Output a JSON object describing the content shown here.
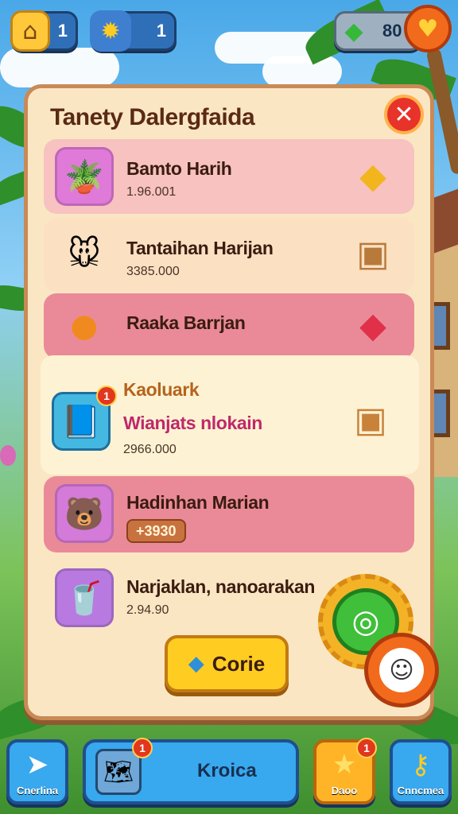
{
  "hud": {
    "home_value": "1",
    "star_value": "1",
    "gem_value": "80"
  },
  "panel": {
    "title": "Tanety Dalergfaida"
  },
  "items": [
    {
      "name": "Bamto Harih",
      "value": "1.96.001"
    },
    {
      "name": "Tantaihan Harijan",
      "value": "3385.000"
    },
    {
      "name": "Raaka Barrjan",
      "value": ""
    },
    {
      "name": "Kaoluark",
      "subtitle": "Wianjats nlokain",
      "value": "2966.000",
      "badge": "1"
    },
    {
      "name": "Hadinhan Marian",
      "value": "+3930"
    },
    {
      "name": "Narjaklan, nanoarakan",
      "value": "2.94.90"
    }
  ],
  "go_button": {
    "label": "Corie"
  },
  "bottom_nav": {
    "left_label": "Cnerlina",
    "main_label": "Kroica",
    "main_badge": "1",
    "deco_label": "Daoo",
    "deco_badge": "1",
    "right_label": "Cnncmea"
  },
  "colors": {
    "panel_bg": "#fbe6c4",
    "row_pink": "#f7c2c0",
    "row_cream": "#fdf3d4",
    "accent_yellow": "#ffcc22",
    "close_red": "#e8332a"
  }
}
